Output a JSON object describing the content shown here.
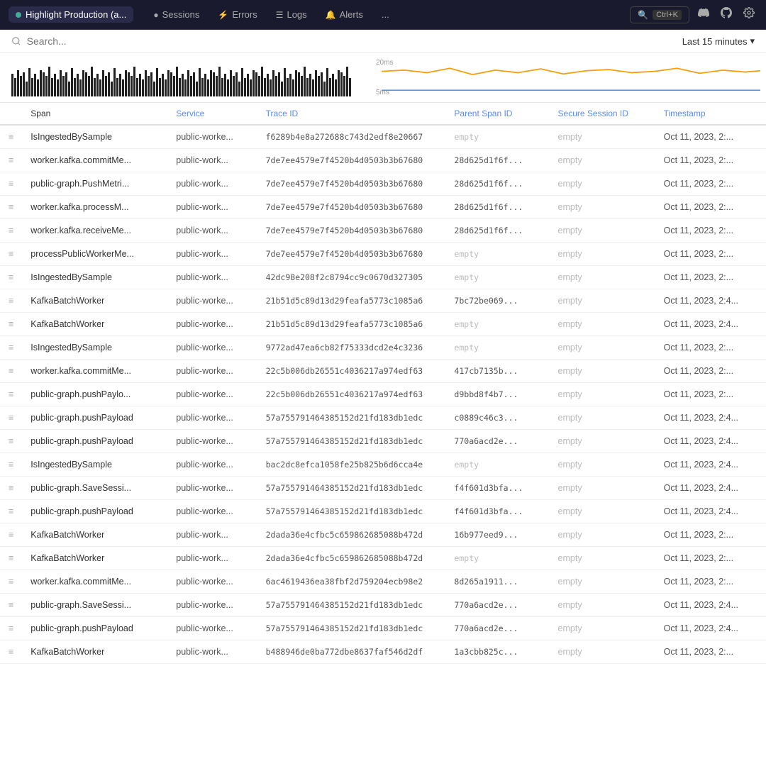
{
  "topnav": {
    "brand": "Highlight Production (a...",
    "brand_dot_color": "#4aaa88",
    "items": [
      {
        "label": "Sessions",
        "icon": "●"
      },
      {
        "label": "Errors",
        "icon": "⚡"
      },
      {
        "label": "Logs",
        "icon": "☰"
      },
      {
        "label": "Alerts",
        "icon": "🔔"
      },
      {
        "label": "...",
        "icon": ""
      }
    ],
    "search_label": "Ctrl+K",
    "discord_icon": "discord",
    "github_icon": "github",
    "settings_icon": "settings"
  },
  "searchbar": {
    "placeholder": "Search...",
    "time_filter": "Last 15 minutes",
    "chevron": "▾"
  },
  "chart": {
    "y_labels": [
      "20ms",
      "5ms"
    ],
    "barcode_bars": 120
  },
  "table": {
    "columns": [
      "Span",
      "Service",
      "Trace ID",
      "Parent Span ID",
      "Secure Session ID",
      "Timestamp"
    ],
    "rows": [
      {
        "menu": "≡",
        "span": "IsIngestedBySample",
        "service": "public-worke...",
        "trace_id": "f6289b4e8a272688c743d2edf8e20667",
        "parent_span_id": "empty",
        "session_id": "empty",
        "timestamp": "Oct 11, 2023, 2:..."
      },
      {
        "menu": "≡",
        "span": "worker.kafka.commitMe...",
        "service": "public-work...",
        "trace_id": "7de7ee4579e7f4520b4d0503b3b67680",
        "parent_span_id": "28d625d1f6f...",
        "session_id": "empty",
        "timestamp": "Oct 11, 2023, 2:..."
      },
      {
        "menu": "≡",
        "span": "public-graph.PushMetri...",
        "service": "public-work...",
        "trace_id": "7de7ee4579e7f4520b4d0503b3b67680",
        "parent_span_id": "28d625d1f6f...",
        "session_id": "empty",
        "timestamp": "Oct 11, 2023, 2:..."
      },
      {
        "menu": "≡",
        "span": "worker.kafka.processM...",
        "service": "public-work...",
        "trace_id": "7de7ee4579e7f4520b4d0503b3b67680",
        "parent_span_id": "28d625d1f6f...",
        "session_id": "empty",
        "timestamp": "Oct 11, 2023, 2:..."
      },
      {
        "menu": "≡",
        "span": "worker.kafka.receiveMe...",
        "service": "public-work...",
        "trace_id": "7de7ee4579e7f4520b4d0503b3b67680",
        "parent_span_id": "28d625d1f6f...",
        "session_id": "empty",
        "timestamp": "Oct 11, 2023, 2:..."
      },
      {
        "menu": "≡",
        "span": "processPublicWorkerMe...",
        "service": "public-work...",
        "trace_id": "7de7ee4579e7f4520b4d0503b3b67680",
        "parent_span_id": "empty",
        "session_id": "empty",
        "timestamp": "Oct 11, 2023, 2:..."
      },
      {
        "menu": "≡",
        "span": "IsIngestedBySample",
        "service": "public-work...",
        "trace_id": "42dc98e208f2c8794cc9c0670d327305",
        "parent_span_id": "empty",
        "session_id": "empty",
        "timestamp": "Oct 11, 2023, 2:..."
      },
      {
        "menu": "≡",
        "span": "KafkaBatchWorker",
        "service": "public-worke...",
        "trace_id": "21b51d5c89d13d29feafa5773c1085a6",
        "parent_span_id": "7bc72be069...",
        "session_id": "empty",
        "timestamp": "Oct 11, 2023, 2:4..."
      },
      {
        "menu": "≡",
        "span": "KafkaBatchWorker",
        "service": "public-worke...",
        "trace_id": "21b51d5c89d13d29feafa5773c1085a6",
        "parent_span_id": "empty",
        "session_id": "empty",
        "timestamp": "Oct 11, 2023, 2:4..."
      },
      {
        "menu": "≡",
        "span": "IsIngestedBySample",
        "service": "public-worke...",
        "trace_id": "9772ad47ea6cb82f75333dcd2e4c3236",
        "parent_span_id": "empty",
        "session_id": "empty",
        "timestamp": "Oct 11, 2023, 2:..."
      },
      {
        "menu": "≡",
        "span": "worker.kafka.commitMe...",
        "service": "public-worke...",
        "trace_id": "22c5b006db26551c4036217a974edf63",
        "parent_span_id": "417cb7135b...",
        "session_id": "empty",
        "timestamp": "Oct 11, 2023, 2:..."
      },
      {
        "menu": "≡",
        "span": "public-graph.pushPaylo...",
        "service": "public-worke...",
        "trace_id": "22c5b006db26551c4036217a974edf63",
        "parent_span_id": "d9bbd8f4b7...",
        "session_id": "empty",
        "timestamp": "Oct 11, 2023, 2:..."
      },
      {
        "menu": "≡",
        "span": "public-graph.pushPayload",
        "service": "public-worke...",
        "trace_id": "57a755791464385152d21fd183db1edc",
        "parent_span_id": "c0889c46c3...",
        "session_id": "empty",
        "timestamp": "Oct 11, 2023, 2:4..."
      },
      {
        "menu": "≡",
        "span": "public-graph.pushPayload",
        "service": "public-worke...",
        "trace_id": "57a755791464385152d21fd183db1edc",
        "parent_span_id": "770a6acd2e...",
        "session_id": "empty",
        "timestamp": "Oct 11, 2023, 2:4..."
      },
      {
        "menu": "≡",
        "span": "IsIngestedBySample",
        "service": "public-worke...",
        "trace_id": "bac2dc8efca1058fe25b825b6d6cca4e",
        "parent_span_id": "empty",
        "session_id": "empty",
        "timestamp": "Oct 11, 2023, 2:4..."
      },
      {
        "menu": "≡",
        "span": "public-graph.SaveSessi...",
        "service": "public-worke...",
        "trace_id": "57a755791464385152d21fd183db1edc",
        "parent_span_id": "f4f601d3bfa...",
        "session_id": "empty",
        "timestamp": "Oct 11, 2023, 2:4..."
      },
      {
        "menu": "≡",
        "span": "public-graph.pushPayload",
        "service": "public-worke...",
        "trace_id": "57a755791464385152d21fd183db1edc",
        "parent_span_id": "f4f601d3bfa...",
        "session_id": "empty",
        "timestamp": "Oct 11, 2023, 2:4..."
      },
      {
        "menu": "≡",
        "span": "KafkaBatchWorker",
        "service": "public-work...",
        "trace_id": "2dada36e4cfbc5c659862685088b472d",
        "parent_span_id": "16b977eed9...",
        "session_id": "empty",
        "timestamp": "Oct 11, 2023, 2:..."
      },
      {
        "menu": "≡",
        "span": "KafkaBatchWorker",
        "service": "public-work...",
        "trace_id": "2dada36e4cfbc5c659862685088b472d",
        "parent_span_id": "empty",
        "session_id": "empty",
        "timestamp": "Oct 11, 2023, 2:..."
      },
      {
        "menu": "≡",
        "span": "worker.kafka.commitMe...",
        "service": "public-worke...",
        "trace_id": "6ac4619436ea38fbf2d759204ecb98e2",
        "parent_span_id": "8d265a1911...",
        "session_id": "empty",
        "timestamp": "Oct 11, 2023, 2:..."
      },
      {
        "menu": "≡",
        "span": "public-graph.SaveSessi...",
        "service": "public-worke...",
        "trace_id": "57a755791464385152d21fd183db1edc",
        "parent_span_id": "770a6acd2e...",
        "session_id": "empty",
        "timestamp": "Oct 11, 2023, 2:4..."
      },
      {
        "menu": "≡",
        "span": "public-graph.pushPayload",
        "service": "public-worke...",
        "trace_id": "57a755791464385152d21fd183db1edc",
        "parent_span_id": "770a6acd2e...",
        "session_id": "empty",
        "timestamp": "Oct 11, 2023, 2:4..."
      },
      {
        "menu": "≡",
        "span": "KafkaBatchWorker",
        "service": "public-work...",
        "trace_id": "b488946de0ba772dbe8637faf546d2df",
        "parent_span_id": "1a3cbb825c...",
        "session_id": "empty",
        "timestamp": "Oct 11, 2023, 2:..."
      }
    ]
  }
}
